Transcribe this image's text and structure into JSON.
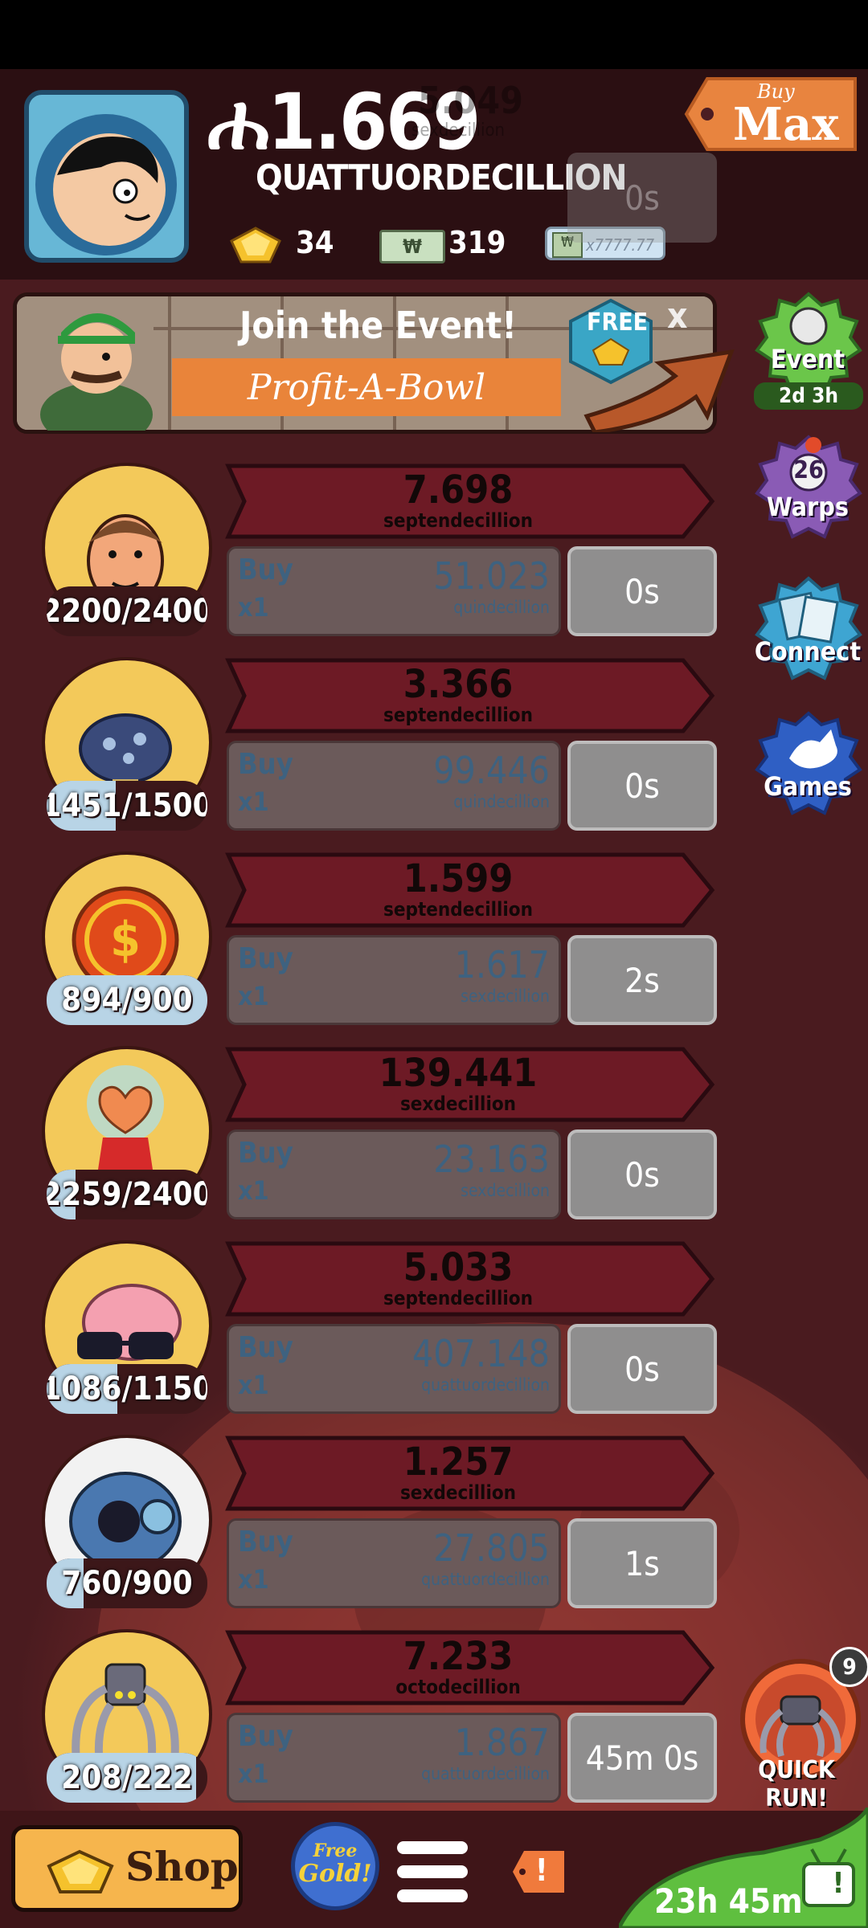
{
  "header": {
    "money_symbol": "ሐ",
    "money_value": "1.669",
    "money_unit": "QUATTUORDECILLION",
    "gold_count": "34",
    "megabucks_count": "319",
    "mega_ticket_label": "x7777.77",
    "buy_max_small": "Buy",
    "buy_max_big": "Max"
  },
  "ghost_row": {
    "value": "5.049",
    "unit": "sexdecillion",
    "time": "0s"
  },
  "event_banner": {
    "title": "Join the Event!",
    "subtitle": "Profit-A-Bowl",
    "free_label": "FREE",
    "close_label": "x"
  },
  "side": {
    "event_label": "Event",
    "event_timer": "2d 3h",
    "warps_count": "26",
    "warps_label": "Warps",
    "connect_label": "Connect",
    "games_label": "Games",
    "quick_run_label": "QUICK RUN!",
    "quick_run_badge": "9"
  },
  "rows": [
    {
      "count": "2200/2400",
      "fill": 0.0,
      "profit": "7.698",
      "profit_unit": "septendecillion",
      "buy": "Buy",
      "mult": "x1",
      "cost": "51.023",
      "cost_unit": "quindecillion",
      "time": "0s"
    },
    {
      "count": "1451/1500",
      "fill": 0.43,
      "profit": "3.366",
      "profit_unit": "septendecillion",
      "buy": "Buy",
      "mult": "x1",
      "cost": "99.446",
      "cost_unit": "quindecillion",
      "time": "0s"
    },
    {
      "count": "894/900",
      "fill": 1.0,
      "profit": "1.599",
      "profit_unit": "septendecillion",
      "buy": "Buy",
      "mult": "x1",
      "cost": "1.617",
      "cost_unit": "sexdecillion",
      "time": "2s"
    },
    {
      "count": "2259/2400",
      "fill": 0.18,
      "profit": "139.441",
      "profit_unit": "sexdecillion",
      "buy": "Buy",
      "mult": "x1",
      "cost": "23.163",
      "cost_unit": "sexdecillion",
      "time": "0s"
    },
    {
      "count": "1086/1150",
      "fill": 0.44,
      "profit": "5.033",
      "profit_unit": "septendecillion",
      "buy": "Buy",
      "mult": "x1",
      "cost": "407.148",
      "cost_unit": "quattuordecillion",
      "time": "0s"
    },
    {
      "count": "760/900",
      "fill": 0.23,
      "profit": "1.257",
      "profit_unit": "sexdecillion",
      "buy": "Buy",
      "mult": "x1",
      "cost": "27.805",
      "cost_unit": "quattuordecillion",
      "time": "1s"
    },
    {
      "count": "208/222",
      "fill": 0.93,
      "profit": "7.233",
      "profit_unit": "octodecillion",
      "buy": "Buy",
      "mult": "x1",
      "cost": "1.867",
      "cost_unit": "quattuordecillion",
      "time": "45m 0s"
    }
  ],
  "row_icons": [
    "face-icon",
    "ladybug-icon",
    "coin-icon",
    "heart-creature-icon",
    "brain-icon",
    "robot-eye-icon",
    "spider-icon"
  ],
  "bottom": {
    "shop_label": "Shop",
    "free_gold_line1": "Free",
    "free_gold_line2": "Gold!",
    "alert_label": "!",
    "timer": "23h 45m",
    "tv_label": "!"
  }
}
